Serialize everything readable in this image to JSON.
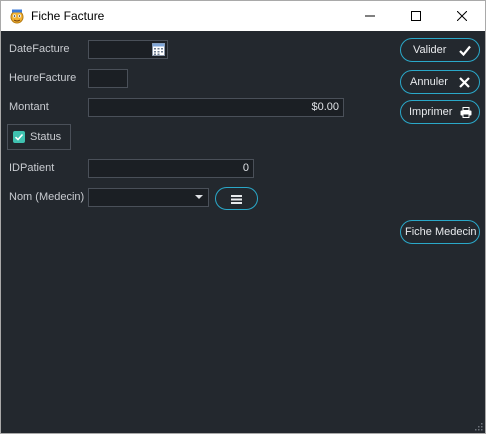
{
  "window": {
    "title": "Fiche Facture"
  },
  "form": {
    "date_label": "DateFacture",
    "time_label": "HeureFacture",
    "amount_label": "Montant",
    "amount_value": "$0.00",
    "status_label": "Status",
    "patient_label": "IDPatient",
    "patient_value": "0",
    "doctor_label": "Nom (Medecin)"
  },
  "buttons": {
    "validate": "Valider",
    "cancel": "Annuler",
    "print": "Imprimer",
    "doctor_sheet": "Fiche Medecin"
  },
  "colors": {
    "background": "#23282e",
    "accent": "#2aa8c9",
    "checkbox": "#3fc1b0"
  },
  "icons": [
    "app-icon",
    "calendar-icon",
    "check-icon",
    "close-icon",
    "printer-icon",
    "menu-icon",
    "chevron-down-icon",
    "minimize-icon",
    "maximize-icon",
    "close-window-icon"
  ]
}
